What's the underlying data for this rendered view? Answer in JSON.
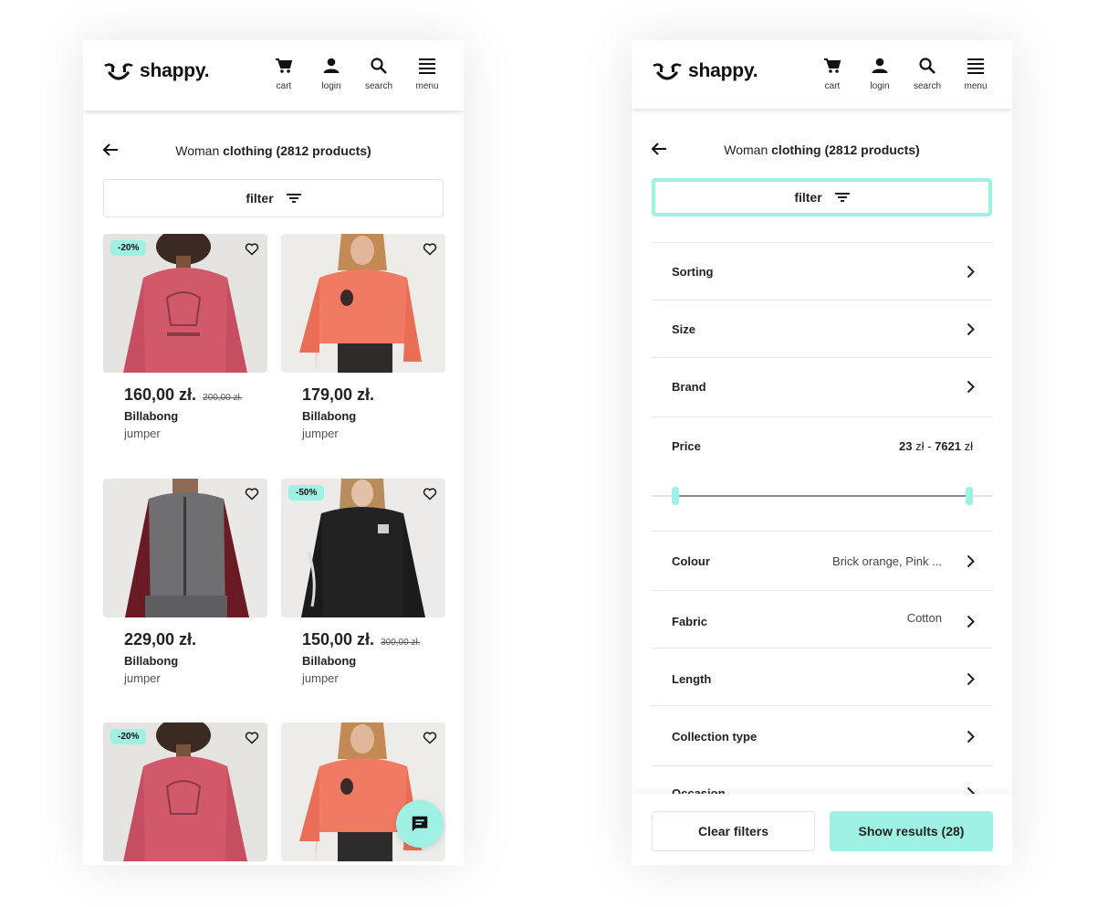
{
  "brand": {
    "logo_text": "shappy."
  },
  "nav": [
    {
      "key": "cart",
      "label": "cart",
      "icon": "cart-icon"
    },
    {
      "key": "login",
      "label": "login",
      "icon": "user-icon"
    },
    {
      "key": "search",
      "label": "search",
      "icon": "search-icon"
    },
    {
      "key": "menu",
      "label": "menu",
      "icon": "hamburger-icon"
    }
  ],
  "page": {
    "title_prefix": "Woman ",
    "title_bold": "clothing (2812 products)"
  },
  "filter_button": {
    "label": "filter",
    "icon": "filter-icon"
  },
  "products": [
    {
      "badge": "-20%",
      "price": "160,00 zł.",
      "old_price": "200,00 zł.",
      "brand": "Billabong",
      "type": "jumper",
      "image": "pink hoodie"
    },
    {
      "badge": "",
      "price": "179,00 zł.",
      "old_price": "",
      "brand": "Billabong",
      "type": "jumper",
      "image": "coral hoodie"
    },
    {
      "badge": "",
      "price": "229,00 zł.",
      "old_price": "",
      "brand": "Billabong",
      "type": "jumper",
      "image": "grey maroon zip hoodie"
    },
    {
      "badge": "-50%",
      "price": "150,00 zł.",
      "old_price": "300,00 zł.",
      "brand": "Billabong",
      "type": "jumper",
      "image": "black hoodie"
    },
    {
      "badge": "-20%",
      "price": "",
      "old_price": "",
      "brand": "",
      "type": "",
      "image": "pink hoodie"
    },
    {
      "badge": "",
      "price": "",
      "old_price": "",
      "brand": "",
      "type": "",
      "image": "coral hoodie"
    }
  ],
  "filters": {
    "sorting": {
      "label": "Sorting"
    },
    "size": {
      "label": "Size"
    },
    "brand": {
      "label": "Brand"
    },
    "price": {
      "label": "Price",
      "value_low": "23",
      "value_sep": " zł - ",
      "value_high": "7621",
      "value_unit": " zł",
      "range_min": 23,
      "range_max": 7621
    },
    "colour": {
      "label": "Colour",
      "value": "Brick orange, Pink ..."
    },
    "fabric": {
      "label": "Fabric",
      "value": "Cotton"
    },
    "length": {
      "label": "Length"
    },
    "collection": {
      "label": "Collection type"
    },
    "occasion": {
      "label": "Occasion"
    }
  },
  "actions": {
    "clear": "Clear filters",
    "show": "Show results (28)"
  },
  "colors": {
    "accent": "#9ff2e3",
    "text": "#222222",
    "border": "#e6e6e6"
  }
}
